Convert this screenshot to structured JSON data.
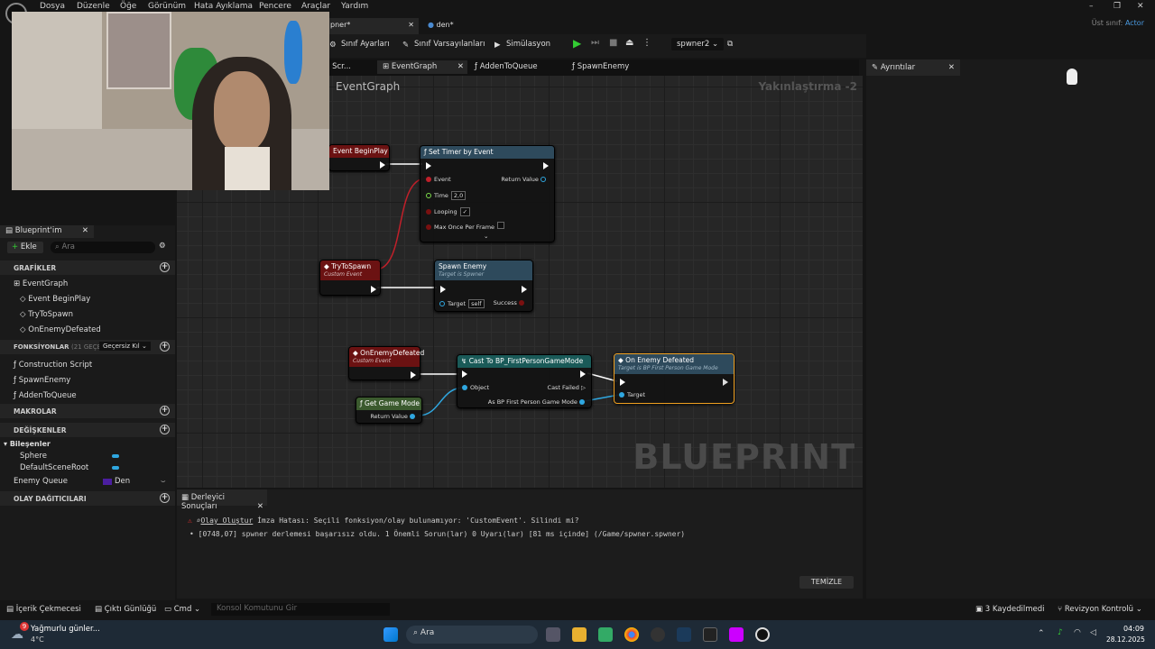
{
  "menu": [
    "Dosya",
    "Düzenle",
    "Öğe",
    "Görünüm",
    "Hata Ayıklama",
    "Pencere",
    "Araçlar",
    "Yardım"
  ],
  "parent_class": {
    "label": "Üst sınıf:",
    "value": "Actor"
  },
  "doc_tabs": [
    {
      "label": "pner*"
    },
    {
      "label": "den*"
    }
  ],
  "toolbar": {
    "class_settings": "Sınıf Ayarları",
    "class_defaults": "Sınıf Varsayılanları",
    "simulation": "Simülasyon",
    "debug_object": "spwner2"
  },
  "graph_tabs": [
    "n Scr...",
    "EventGraph",
    "AddenToQueue",
    "SpawnEnemy"
  ],
  "details_tab": "Ayrıntılar",
  "graph": {
    "title": "EventGraph",
    "zoom": "Yakınlaştırma -2",
    "watermark": "BLUEPRINT",
    "nodes": {
      "begin_play": {
        "title": "Event BeginPlay"
      },
      "set_timer": {
        "title": "Set Timer by Event",
        "event": "Event",
        "return_value": "Return Value",
        "time": "Time",
        "time_value": "2,0",
        "looping": "Looping",
        "max_once": "Max Once Per Frame"
      },
      "try_to_spawn": {
        "title": "TryToSpawn",
        "subtitle": "Custom Event"
      },
      "spawn_enemy": {
        "title": "Spawn Enemy",
        "subtitle": "Target is Spwner",
        "target": "Target",
        "target_value": "self",
        "success": "Success"
      },
      "on_enemy_defeated_evt": {
        "title": "OnEnemyDefeated",
        "subtitle": "Custom Event"
      },
      "cast": {
        "title": "Cast To BP_FirstPersonGameMode",
        "object": "Object",
        "cast_failed": "Cast Failed",
        "as_bp": "As BP First Person Game Mode"
      },
      "get_game_mode": {
        "title": "Get Game Mode",
        "return_value": "Return Value"
      },
      "on_enemy_defeated_fn": {
        "title": "On Enemy Defeated",
        "subtitle": "Target is BP First Person Game Mode",
        "target": "Target"
      }
    }
  },
  "my_blueprint": {
    "tab": "Blueprint'im",
    "add": "Ekle",
    "search_placeholder": "Ara",
    "graphs_header": "GRAFİKLER",
    "event_graph": "EventGraph",
    "graph_items": [
      "Event BeginPlay",
      "TryToSpawn",
      "OnEnemyDefeated"
    ],
    "functions_header": "FONKSİYONLAR",
    "functions_count": "(21 GEÇERSİ",
    "override": "Geçersiz Kıl",
    "function_items": [
      "Construction Script",
      "SpawnEnemy",
      "AddenToQueue"
    ],
    "macros_header": "MAKROLAR",
    "variables_header": "DEĞİŞKENLER",
    "components_header": "Bileşenler",
    "components": [
      "Sphere",
      "DefaultSceneRoot"
    ],
    "variable_name": "Enemy Queue",
    "variable_type": "Den",
    "dispatchers_header": "OLAY DAĞITICILARI"
  },
  "compiler": {
    "tab": "Derleyici Sonuçları",
    "line1_link": "Olay Oluştur",
    "line1_text": "İmza Hatası: Seçili fonksiyon/olay bulunamıyor: 'CustomEvent'. Silindi mi?",
    "line2_text": "[0748,07] spwner derlemesi başarısız oldu. 1 Önemli Sorun(lar) 0 Uyarı(lar) [81 ms içinde] (/Game/spwner.spwner)",
    "clear": "TEMİZLE"
  },
  "bottom_bar": {
    "content_drawer": "İçerik Çekmecesi",
    "output_log": "Çıktı Günlüğü",
    "cmd": "Cmd",
    "console_placeholder": "Konsol Komutunu Gir",
    "saved": "3 Kaydedilmedi",
    "revision": "Revizyon Kontrolü"
  },
  "taskbar": {
    "weather_title": "Yağmurlu günler...",
    "weather_temp": "4°C",
    "weather_badge": "9",
    "search": "Ara",
    "time": "04:09",
    "date": "28.12.2025"
  },
  "colors": {
    "exec_header": "#6b1212",
    "function_header": "#2e4a5c",
    "cast_header": "#1a5a58",
    "pure_header": "#3b5a2e",
    "selected": "#f0a020",
    "link_blue": "#2fa7e0"
  }
}
